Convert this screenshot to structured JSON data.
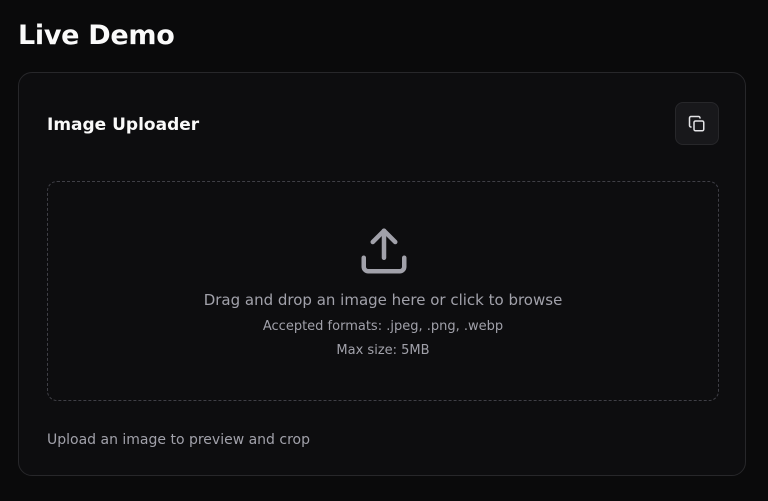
{
  "page": {
    "title": "Live Demo"
  },
  "card": {
    "title": "Image Uploader",
    "copy_button_icon": "copy-icon"
  },
  "dropzone": {
    "icon": "upload-icon",
    "main_text": "Drag and drop an image here or click to browse",
    "formats_text": "Accepted formats: .jpeg, .png, .webp",
    "size_text": "Max size: 5MB"
  },
  "helper": {
    "text": "Upload an image to preview and crop"
  },
  "colors": {
    "background": "#0a0a0b",
    "card_border": "#27272a",
    "muted_text": "#a1a1aa",
    "heading_text": "#fafafa"
  }
}
